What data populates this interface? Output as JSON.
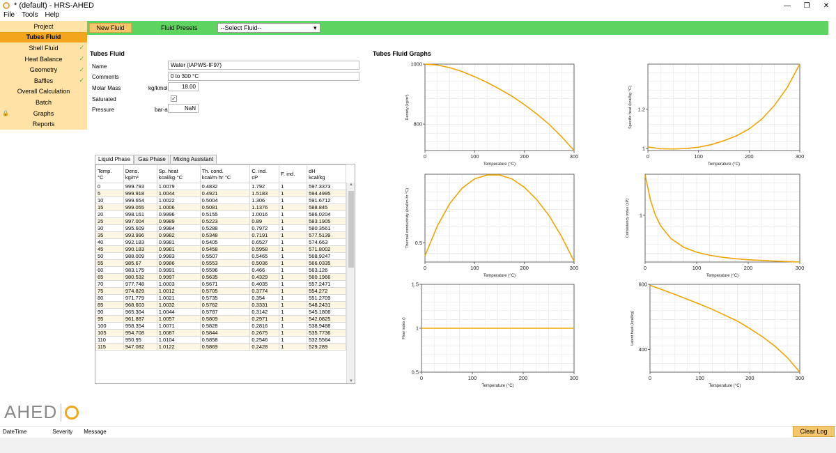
{
  "window": {
    "title": "* (default) - HRS-AHED"
  },
  "menu": [
    "File",
    "Tools",
    "Help"
  ],
  "sidebar": [
    {
      "label": "Project",
      "check": false,
      "lock": false,
      "active": false
    },
    {
      "label": "Tubes Fluid",
      "check": false,
      "lock": false,
      "active": true
    },
    {
      "label": "Shell Fluid",
      "check": true,
      "lock": false,
      "active": false
    },
    {
      "label": "Heat Balance",
      "check": true,
      "lock": false,
      "active": false
    },
    {
      "label": "Geometry",
      "check": true,
      "lock": false,
      "active": false
    },
    {
      "label": "Baffles",
      "check": true,
      "lock": false,
      "active": false
    },
    {
      "label": "Overall Calculation",
      "check": false,
      "lock": false,
      "active": false
    },
    {
      "label": "Batch",
      "check": false,
      "lock": false,
      "active": false
    },
    {
      "label": "Graphs",
      "check": false,
      "lock": true,
      "active": false
    },
    {
      "label": "Reports",
      "check": false,
      "lock": false,
      "active": false
    }
  ],
  "logo": {
    "text": "AHED"
  },
  "toolbar": {
    "new_fluid": "New Fluid",
    "presets_label": "Fluid Presets",
    "select_value": "--Select Fluid--"
  },
  "form": {
    "title": "Tubes Fluid",
    "name_label": "Name",
    "name_value": "Water (IAPWS-IF97)",
    "comments_label": "Comments",
    "comments_value": "0 to 300 °C",
    "molar_label": "Molar Mass",
    "molar_unit": "kg/kmol",
    "molar_value": "18.00",
    "saturated_label": "Saturated",
    "pressure_label": "Pressure",
    "pressure_unit": "bar-a",
    "pressure_value": "NaN"
  },
  "tabs": [
    "Liquid Phase",
    "Gas Phase",
    "Mixing Assistant"
  ],
  "table": {
    "headers": [
      [
        "Temp.",
        "°C"
      ],
      [
        "Dens.",
        "kg/m³"
      ],
      [
        "Sp. heat",
        "kcal/kg·°C"
      ],
      [
        "Th. cond.",
        "kcal/m·hr·°C"
      ],
      [
        "C. ind.",
        "cP"
      ],
      [
        "F. ind.",
        ""
      ],
      [
        "dH",
        "kcal/kg"
      ]
    ],
    "rows": [
      [
        "0",
        "999.793",
        "1.0079",
        "0.4832",
        "1.792",
        "1",
        "597.3373"
      ],
      [
        "5",
        "999.918",
        "1.0044",
        "0.4921",
        "1.5183",
        "1",
        "594.4995"
      ],
      [
        "10",
        "999.654",
        "1.0022",
        "0.5004",
        "1.306",
        "1",
        "591.6712"
      ],
      [
        "15",
        "999.055",
        "1.0006",
        "0.5081",
        "1.1376",
        "1",
        "588.845"
      ],
      [
        "20",
        "998.161",
        "0.9996",
        "0.5155",
        "1.0016",
        "1",
        "586.0204"
      ],
      [
        "25",
        "997.004",
        "0.9989",
        "0.5223",
        "0.89",
        "1",
        "583.1905"
      ],
      [
        "30",
        "995.609",
        "0.9984",
        "0.5288",
        "0.7972",
        "1",
        "580.3561"
      ],
      [
        "35",
        "993.996",
        "0.9982",
        "0.5348",
        "0.7191",
        "1",
        "577.5139"
      ],
      [
        "40",
        "992.183",
        "0.9981",
        "0.5405",
        "0.6527",
        "1",
        "574.663"
      ],
      [
        "45",
        "990.183",
        "0.9981",
        "0.5458",
        "0.5958",
        "1",
        "571.8002"
      ],
      [
        "50",
        "988.009",
        "0.9983",
        "0.5507",
        "0.5465",
        "1",
        "568.9247"
      ],
      [
        "55",
        "985.67",
        "0.9986",
        "0.5553",
        "0.5036",
        "1",
        "566.0335"
      ],
      [
        "60",
        "983.175",
        "0.9991",
        "0.5596",
        "0.466",
        "1",
        "563.126"
      ],
      [
        "65",
        "980.532",
        "0.9997",
        "0.5635",
        "0.4329",
        "1",
        "560.1966"
      ],
      [
        "70",
        "977.748",
        "1.0003",
        "0.5671",
        "0.4035",
        "1",
        "557.2471"
      ],
      [
        "75",
        "974.829",
        "1.0012",
        "0.5705",
        "0.3774",
        "1",
        "554.272"
      ],
      [
        "80",
        "971.779",
        "1.0021",
        "0.5735",
        "0.354",
        "1",
        "551.2709"
      ],
      [
        "85",
        "968.603",
        "1.0032",
        "0.5762",
        "0.3331",
        "1",
        "548.2431"
      ],
      [
        "90",
        "965.304",
        "1.0044",
        "0.5787",
        "0.3142",
        "1",
        "545.1806"
      ],
      [
        "95",
        "961.887",
        "1.0057",
        "0.5809",
        "0.2971",
        "1",
        "542.0825"
      ],
      [
        "100",
        "958.354",
        "1.0071",
        "0.5828",
        "0.2816",
        "1",
        "538.9488"
      ],
      [
        "105",
        "954.708",
        "1.0087",
        "0.5844",
        "0.2675",
        "1",
        "535.7736"
      ],
      [
        "110",
        "950.95",
        "1.0104",
        "0.5858",
        "0.2546",
        "1",
        "532.5564"
      ],
      [
        "115",
        "947.082",
        "1.0122",
        "0.5869",
        "0.2428",
        "1",
        "529.289"
      ]
    ]
  },
  "graphs_title": "Tubes Fluid Graphs",
  "colors": {
    "accent": "#f2a61e",
    "toolbar": "#5fd35f",
    "curve": "#f0a500"
  },
  "chart_data": [
    {
      "type": "line",
      "xlabel": "Temperature (°C)",
      "ylabel": "Density (kg/m³)",
      "xlim": [
        0,
        300
      ],
      "ylim": [
        712,
        1000
      ],
      "x": [
        0,
        25,
        50,
        75,
        100,
        125,
        150,
        175,
        200,
        225,
        250,
        275,
        300
      ],
      "y": [
        1000,
        997,
        988,
        975,
        958,
        939,
        917,
        893,
        865,
        834,
        799,
        758,
        712
      ],
      "xticks": [
        "0",
        "100",
        "200",
        "300"
      ],
      "yticks": [
        {
          "v": 1000,
          "l": "1000"
        },
        {
          "v": 800,
          "l": "800"
        }
      ]
    },
    {
      "type": "line",
      "xlabel": "Temperature (°C)",
      "ylabel": "Specific heat (kcal/kg·°C)",
      "xlim": [
        0,
        300
      ],
      "ylim": [
        0.99,
        1.43
      ],
      "x": [
        0,
        25,
        50,
        75,
        100,
        125,
        150,
        175,
        200,
        225,
        250,
        275,
        300
      ],
      "y": [
        1.008,
        0.999,
        0.998,
        1.0,
        1.007,
        1.02,
        1.04,
        1.065,
        1.1,
        1.15,
        1.22,
        1.31,
        1.43
      ],
      "xticks": [
        "0",
        "100",
        "200",
        "300"
      ],
      "yticks": [
        {
          "v": 1.2,
          "l": "1.2"
        },
        {
          "v": 1.0,
          "l": "1"
        }
      ]
    },
    {
      "type": "line",
      "xlabel": "Temperature (°C)",
      "ylabel": "Thermal conductivity (kcal/m·hr·°C)",
      "xlim": [
        0,
        300
      ],
      "ylim": [
        0.475,
        0.589
      ],
      "x": [
        0,
        25,
        50,
        75,
        100,
        125,
        150,
        175,
        200,
        225,
        250,
        275,
        300
      ],
      "y": [
        0.483,
        0.522,
        0.551,
        0.571,
        0.583,
        0.588,
        0.588,
        0.583,
        0.572,
        0.556,
        0.535,
        0.508,
        0.476
      ],
      "xticks": [
        "0",
        "100",
        "200",
        "300"
      ],
      "yticks": [
        {
          "v": 0.5,
          "l": "0.5"
        }
      ]
    },
    {
      "type": "line",
      "xlabel": "Temperature (°C)",
      "ylabel": "Consistency index (cP)",
      "xlim": [
        0,
        300
      ],
      "ylim": [
        0.09,
        1.8
      ],
      "x": [
        0,
        10,
        20,
        30,
        50,
        75,
        100,
        125,
        150,
        175,
        200,
        250,
        300
      ],
      "y": [
        1.792,
        1.306,
        1.002,
        0.797,
        0.547,
        0.377,
        0.282,
        0.222,
        0.183,
        0.155,
        0.135,
        0.109,
        0.091
      ],
      "xticks": [
        "0",
        "100",
        "200",
        "300"
      ],
      "yticks": [
        {
          "v": 1.0,
          "l": "1"
        }
      ]
    },
    {
      "type": "line",
      "xlabel": "Temperature (°C)",
      "ylabel": "Flow index ()",
      "xlim": [
        0,
        300
      ],
      "ylim": [
        0.5,
        1.5
      ],
      "x": [
        0,
        300
      ],
      "y": [
        1,
        1
      ],
      "xticks": [
        "0",
        "100",
        "200",
        "300"
      ],
      "yticks": [
        {
          "v": 1.5,
          "l": "1.5"
        },
        {
          "v": 1.0,
          "l": "1"
        },
        {
          "v": 0.5,
          "l": "0.5"
        }
      ]
    },
    {
      "type": "line",
      "xlabel": "Temperature (°C)",
      "ylabel": "Latent heat (kcal/kg)",
      "xlim": [
        0,
        300
      ],
      "ylim": [
        330,
        600
      ],
      "x": [
        0,
        25,
        50,
        75,
        100,
        125,
        150,
        175,
        200,
        225,
        250,
        275,
        300
      ],
      "y": [
        597,
        583,
        569,
        554,
        539,
        523,
        505,
        487,
        464,
        439,
        410,
        375,
        330
      ],
      "xticks": [
        "0",
        "100",
        "200",
        "300"
      ],
      "yticks": [
        {
          "v": 600,
          "l": "600"
        },
        {
          "v": 400,
          "l": "400"
        }
      ]
    }
  ],
  "status": {
    "datetime": "DateTime",
    "severity": "Severity",
    "message": "Message",
    "clear_log": "Clear Log"
  }
}
